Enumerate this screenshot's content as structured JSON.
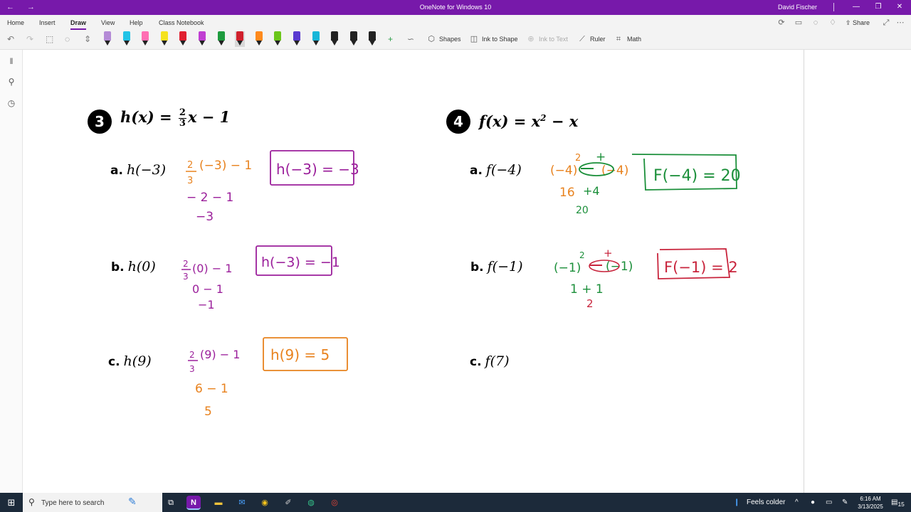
{
  "titlebar": {
    "title": "OneNote for Windows 10",
    "user": "David Fischer",
    "back": "←",
    "forward": "→",
    "minimize": "—",
    "restore": "❐",
    "close": "✕"
  },
  "ribbon": {
    "tabs": [
      "Home",
      "Insert",
      "Draw",
      "View",
      "Help",
      "Class Notebook"
    ],
    "active_tab": "Draw",
    "share": "Share"
  },
  "toolbar": {
    "shapes": "Shapes",
    "ink_to_shape": "Ink to Shape",
    "ink_to_text": "Ink to Text",
    "ruler": "Ruler",
    "math": "Math",
    "pens": [
      {
        "color": "#b48bd6",
        "name": "pen-lavender"
      },
      {
        "color": "#22c3e6",
        "name": "highlighter-cyan"
      },
      {
        "color": "#ff6fb3",
        "name": "highlighter-pink"
      },
      {
        "color": "#f5e21f",
        "name": "highlighter-yellow"
      },
      {
        "color": "#e02030",
        "name": "pen-red"
      },
      {
        "color": "#c03fd2",
        "name": "pen-magenta"
      },
      {
        "color": "#1e9b3e",
        "name": "pen-green"
      },
      {
        "color": "#d0202c",
        "name": "pen-red-selected"
      },
      {
        "color": "#ff8a1c",
        "name": "pen-orange"
      },
      {
        "color": "#6bc61a",
        "name": "pen-lime"
      },
      {
        "color": "#5a3ad0",
        "name": "pen-purple"
      },
      {
        "color": "#17b6d8",
        "name": "pen-teal"
      },
      {
        "color": "#222222",
        "name": "pen-black-1"
      },
      {
        "color": "#222222",
        "name": "pen-black-2"
      },
      {
        "color": "#222222",
        "name": "pen-black-3"
      }
    ],
    "selected_pen": 7
  },
  "page": {
    "problem3": {
      "number": "3",
      "fn": "h(x) = ",
      "frac_num": "2",
      "frac_den": "3",
      "rest": "x − 1",
      "parts": [
        {
          "label": "a.",
          "expr": "h(−3)"
        },
        {
          "label": "b.",
          "expr": "h(0)"
        },
        {
          "label": "c.",
          "expr": "h(9)"
        }
      ]
    },
    "problem4": {
      "number": "4",
      "fn": "f(x) = x",
      "sup": "2",
      "rest": " − x",
      "parts": [
        {
          "label": "a.",
          "expr": "f(−4)"
        },
        {
          "label": "b.",
          "expr": "f(−1)"
        },
        {
          "label": "c.",
          "expr": "f(7)"
        }
      ]
    }
  },
  "ink": {
    "p3a_line1": "(−3) − 1",
    "p3a_line2": "− 2 − 1",
    "p3a_line3": "−3",
    "p3a_frac_num": "2",
    "p3a_frac_den": "3",
    "p3a_answer": "h(−3) = −3",
    "p3b_line1": "(0) − 1",
    "p3b_line2": "0 − 1",
    "p3b_line3": "−1",
    "p3b_frac_num": "2",
    "p3b_frac_den": "3",
    "p3b_answer": "h(−3) = −1",
    "p3c_line1": "(9) − 1",
    "p3c_line2": "6 − 1",
    "p3c_line3": "5",
    "p3c_frac_num": "2",
    "p3c_frac_den": "3",
    "p3c_answer": "h(9) = 5",
    "p4a_line1a": "(−4)",
    "p4a_sup": "2",
    "p4a_plus": "+",
    "p4a_line1b": "(−4)",
    "p4a_line2a": "16",
    "p4a_line2b": "+4",
    "p4a_line3": "20",
    "p4a_answer": "F(−4) = 20",
    "p4b_line1a": "(−1)",
    "p4b_sup": "2",
    "p4b_plus": "+",
    "p4b_line1b": "(−1)",
    "p4b_line2": "1 + 1",
    "p4b_line3": "2",
    "p4b_answer": "F(−1) = 2",
    "colors": {
      "orange": "#e8821e",
      "purple": "#9b1f9b",
      "green": "#1b8f3a",
      "red": "#c8243c"
    }
  },
  "taskbar": {
    "search_placeholder": "Type here to search",
    "weather": "Feels colder",
    "time": "6:16 AM",
    "date": "3/13/2025",
    "notifications": "15"
  }
}
